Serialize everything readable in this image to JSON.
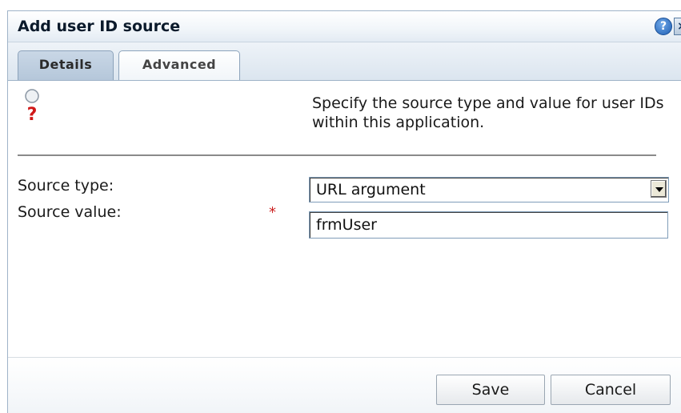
{
  "dialog": {
    "title": "Add user ID source",
    "help_glyph": "?",
    "close_glyph": "×"
  },
  "tabs": [
    {
      "label": "Details",
      "active": true
    },
    {
      "label": "Advanced",
      "active": false
    }
  ],
  "intro": {
    "icon": "question-mark-icon",
    "text": "Specify the source type and value for user IDs within this application."
  },
  "form": {
    "source_type_label": "Source type:",
    "source_type_value": "URL argument",
    "source_value_label": "Source value:",
    "required_marker": "*",
    "source_value": "frmUser"
  },
  "footer": {
    "save_label": "Save",
    "cancel_label": "Cancel"
  },
  "colors": {
    "required": "#cc2222",
    "help_button": "#1f5fb4"
  }
}
